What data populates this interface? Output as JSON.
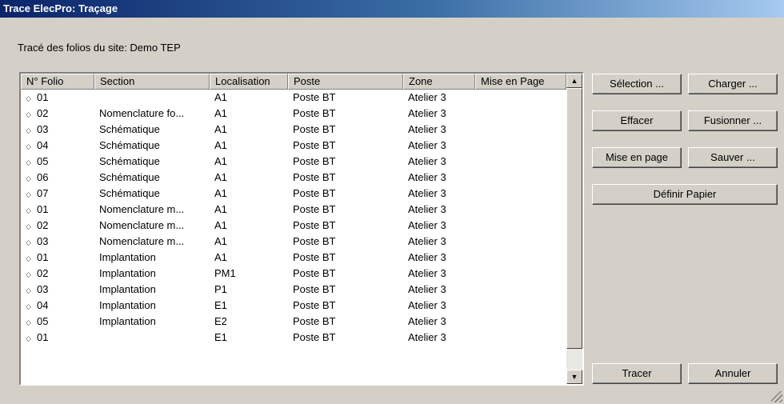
{
  "window": {
    "title": "Trace ElecPro: Traçage"
  },
  "site_label": "Tracé des folios du site: Demo TEP",
  "list": {
    "columns": [
      "N° Folio",
      "Section",
      "Localisation",
      "Poste",
      "Zone",
      "Mise en Page"
    ],
    "rows": [
      [
        "01",
        "",
        "A1",
        "Poste BT",
        "Atelier 3",
        ""
      ],
      [
        "02",
        "Nomenclature fo...",
        "A1",
        "Poste BT",
        "Atelier 3",
        ""
      ],
      [
        "03",
        "Schématique",
        "A1",
        "Poste BT",
        "Atelier 3",
        ""
      ],
      [
        "04",
        "Schématique",
        "A1",
        "Poste BT",
        "Atelier 3",
        ""
      ],
      [
        "05",
        "Schématique",
        "A1",
        "Poste BT",
        "Atelier 3",
        ""
      ],
      [
        "06",
        "Schématique",
        "A1",
        "Poste BT",
        "Atelier 3",
        ""
      ],
      [
        "07",
        "Schématique",
        "A1",
        "Poste BT",
        "Atelier 3",
        ""
      ],
      [
        "01",
        "Nomenclature m...",
        "A1",
        "Poste BT",
        "Atelier 3",
        ""
      ],
      [
        "02",
        "Nomenclature m...",
        "A1",
        "Poste BT",
        "Atelier 3",
        ""
      ],
      [
        "03",
        "Nomenclature m...",
        "A1",
        "Poste BT",
        "Atelier 3",
        ""
      ],
      [
        "01",
        "Implantation",
        "A1",
        "Poste BT",
        "Atelier 3",
        ""
      ],
      [
        "02",
        "Implantation",
        "PM1",
        "Poste BT",
        "Atelier 3",
        ""
      ],
      [
        "03",
        "Implantation",
        "P1",
        "Poste BT",
        "Atelier 3",
        ""
      ],
      [
        "04",
        "Implantation",
        "E1",
        "Poste BT",
        "Atelier 3",
        ""
      ],
      [
        "05",
        "Implantation",
        "E2",
        "Poste BT",
        "Atelier 3",
        ""
      ],
      [
        "01",
        "",
        "E1",
        "Poste BT",
        "Atelier 3",
        ""
      ]
    ],
    "row_icon": "diamond-outline-icon"
  },
  "buttons": {
    "selection": "Sélection ...",
    "charger": "Charger ...",
    "effacer": "Effacer",
    "fusionner": "Fusionner ...",
    "mise_en_page": "Mise en page",
    "sauver": "Sauver ...",
    "definir_papier": "Définir Papier",
    "tracer": "Tracer",
    "annuler": "Annuler"
  },
  "scrollbar": {
    "up_icon": "▲",
    "down_icon": "▼"
  }
}
